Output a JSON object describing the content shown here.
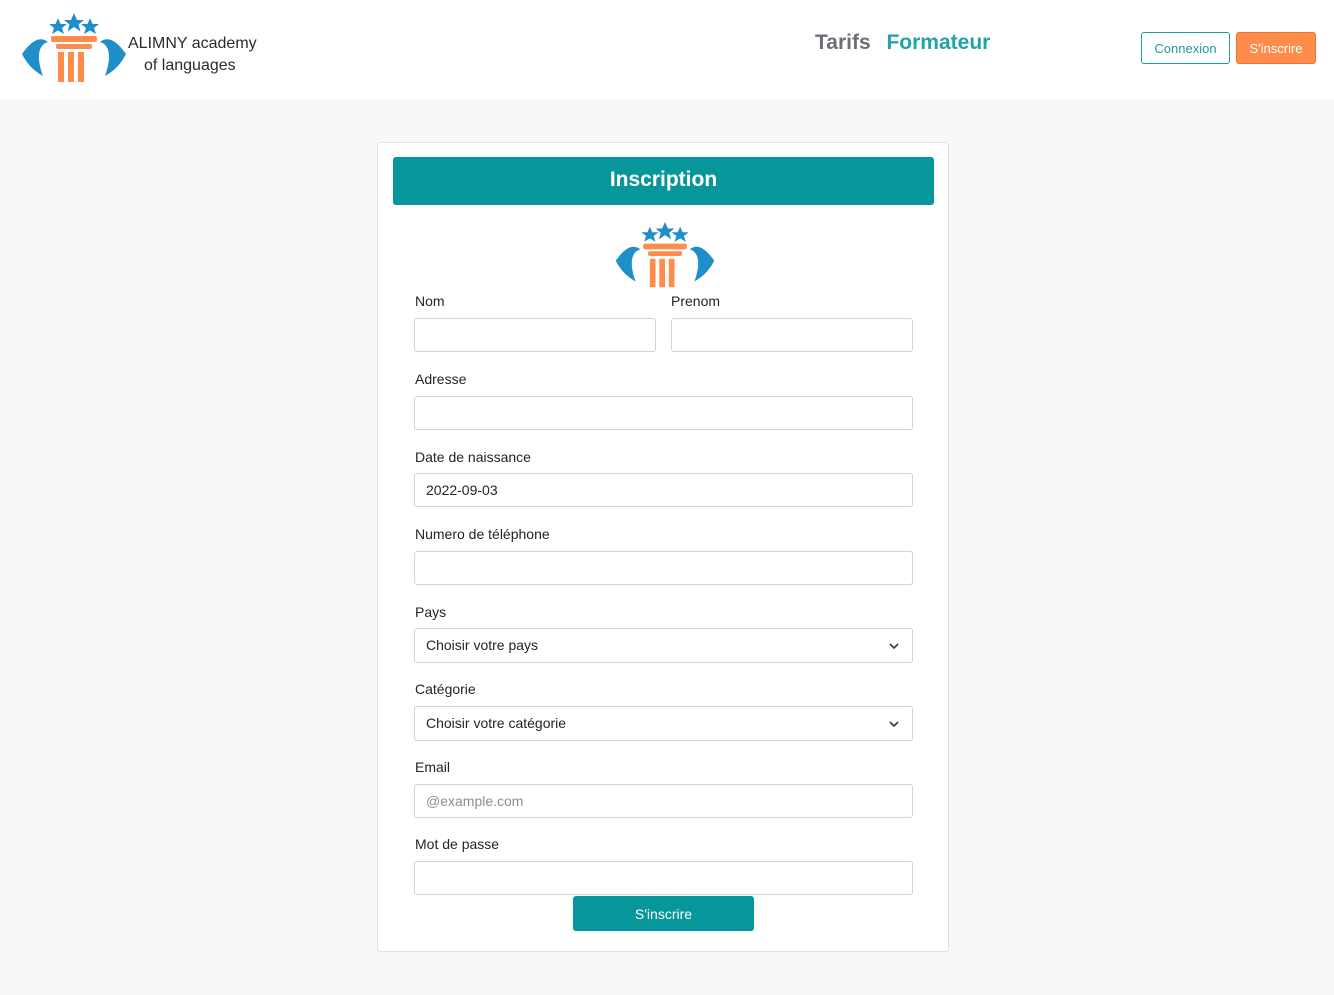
{
  "header": {
    "brand_line1": "ALIMNY academy",
    "brand_line2": "of languages",
    "nav": [
      {
        "label": "Tarifs"
      },
      {
        "label": "Formateur"
      }
    ],
    "login_label": "Connexion",
    "signup_label": "S'inscrire"
  },
  "form": {
    "title": "Inscription",
    "nom_label": "Nom",
    "prenom_label": "Prenom",
    "adresse_label": "Adresse",
    "birthdate_label": "Date de naissance",
    "birthdate_value": "2022-09-03",
    "phone_label": "Numero de téléphone",
    "country_label": "Pays",
    "country_value": "Choisir votre pays",
    "category_label": "Catégorie",
    "category_value": "Choisir votre catégorie",
    "email_label": "Email",
    "email_placeholder": "@example.com",
    "password_label": "Mot de passe",
    "submit_label": "S'inscrire"
  },
  "colors": {
    "primary": "#07979a",
    "accent": "#ff8c4a",
    "logo_blue": "#1e8fc8"
  }
}
